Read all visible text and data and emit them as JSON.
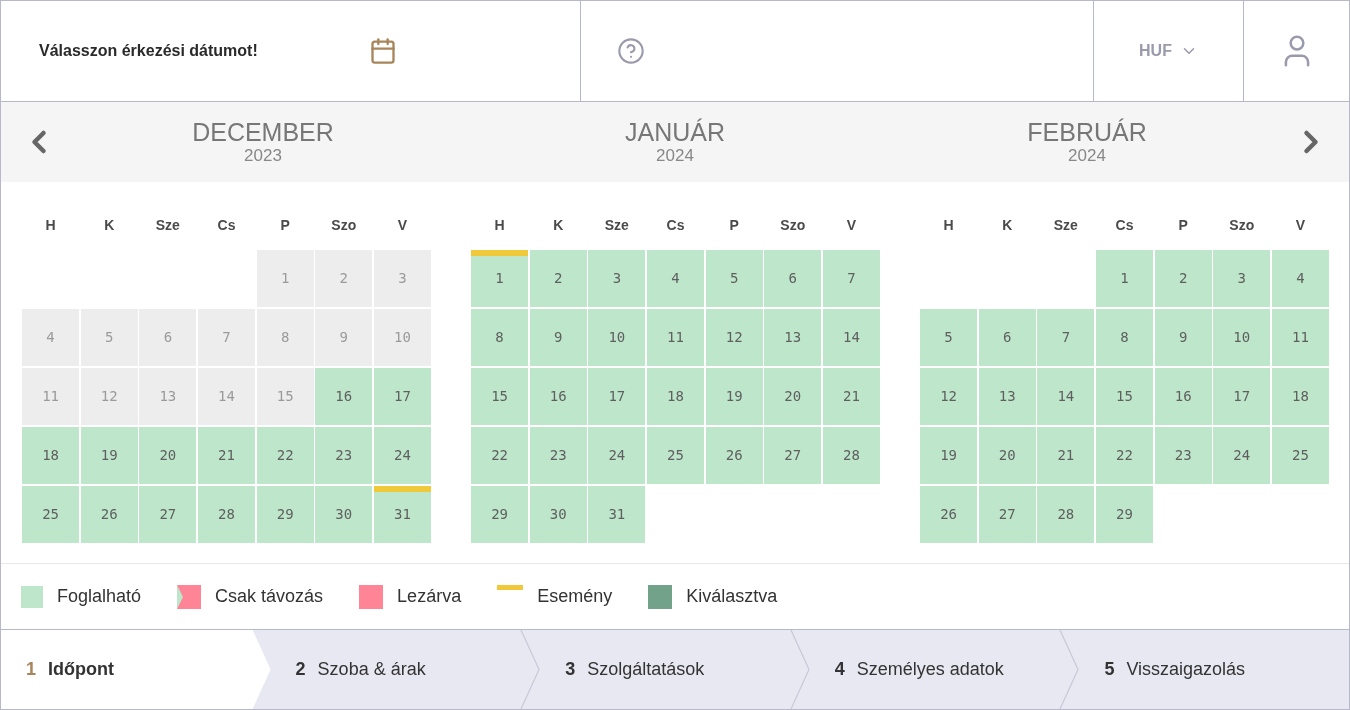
{
  "header": {
    "prompt": "Válasszon érkezési dátumot!",
    "currency": "HUF"
  },
  "months": [
    {
      "name": "DECEMBER",
      "year": "2023",
      "weekdays": [
        "H",
        "K",
        "Sze",
        "Cs",
        "P",
        "Szo",
        "V"
      ],
      "weeks": [
        [
          {
            "kind": "empty"
          },
          {
            "kind": "empty"
          },
          {
            "kind": "empty"
          },
          {
            "kind": "empty"
          },
          {
            "kind": "day",
            "label": "1",
            "disabled": true,
            "event": false
          },
          {
            "kind": "day",
            "label": "2",
            "disabled": true,
            "event": false
          },
          {
            "kind": "day",
            "label": "3",
            "disabled": true,
            "event": false
          }
        ],
        [
          {
            "kind": "day",
            "label": "4",
            "disabled": true,
            "event": false
          },
          {
            "kind": "day",
            "label": "5",
            "disabled": true,
            "event": false
          },
          {
            "kind": "day",
            "label": "6",
            "disabled": true,
            "event": false
          },
          {
            "kind": "day",
            "label": "7",
            "disabled": true,
            "event": false
          },
          {
            "kind": "day",
            "label": "8",
            "disabled": true,
            "event": false
          },
          {
            "kind": "day",
            "label": "9",
            "disabled": true,
            "event": false
          },
          {
            "kind": "day",
            "label": "10",
            "disabled": true,
            "event": false
          }
        ],
        [
          {
            "kind": "day",
            "label": "11",
            "disabled": true,
            "event": false
          },
          {
            "kind": "day",
            "label": "12",
            "disabled": true,
            "event": false
          },
          {
            "kind": "day",
            "label": "13",
            "disabled": true,
            "event": false
          },
          {
            "kind": "day",
            "label": "14",
            "disabled": true,
            "event": false
          },
          {
            "kind": "day",
            "label": "15",
            "disabled": true,
            "event": false
          },
          {
            "kind": "day",
            "label": "16",
            "disabled": false,
            "event": false
          },
          {
            "kind": "day",
            "label": "17",
            "disabled": false,
            "event": false
          }
        ],
        [
          {
            "kind": "day",
            "label": "18",
            "disabled": false,
            "event": false
          },
          {
            "kind": "day",
            "label": "19",
            "disabled": false,
            "event": false
          },
          {
            "kind": "day",
            "label": "20",
            "disabled": false,
            "event": false
          },
          {
            "kind": "day",
            "label": "21",
            "disabled": false,
            "event": false
          },
          {
            "kind": "day",
            "label": "22",
            "disabled": false,
            "event": false
          },
          {
            "kind": "day",
            "label": "23",
            "disabled": false,
            "event": false
          },
          {
            "kind": "day",
            "label": "24",
            "disabled": false,
            "event": false
          }
        ],
        [
          {
            "kind": "day",
            "label": "25",
            "disabled": false,
            "event": false
          },
          {
            "kind": "day",
            "label": "26",
            "disabled": false,
            "event": false
          },
          {
            "kind": "day",
            "label": "27",
            "disabled": false,
            "event": false
          },
          {
            "kind": "day",
            "label": "28",
            "disabled": false,
            "event": false
          },
          {
            "kind": "day",
            "label": "29",
            "disabled": false,
            "event": false
          },
          {
            "kind": "day",
            "label": "30",
            "disabled": false,
            "event": false
          },
          {
            "kind": "day",
            "label": "31",
            "disabled": false,
            "event": true
          }
        ]
      ]
    },
    {
      "name": "JANUÁR",
      "year": "2024",
      "weekdays": [
        "H",
        "K",
        "Sze",
        "Cs",
        "P",
        "Szo",
        "V"
      ],
      "weeks": [
        [
          {
            "kind": "day",
            "label": "1",
            "disabled": false,
            "event": true
          },
          {
            "kind": "day",
            "label": "2",
            "disabled": false,
            "event": false
          },
          {
            "kind": "day",
            "label": "3",
            "disabled": false,
            "event": false
          },
          {
            "kind": "day",
            "label": "4",
            "disabled": false,
            "event": false
          },
          {
            "kind": "day",
            "label": "5",
            "disabled": false,
            "event": false
          },
          {
            "kind": "day",
            "label": "6",
            "disabled": false,
            "event": false
          },
          {
            "kind": "day",
            "label": "7",
            "disabled": false,
            "event": false
          }
        ],
        [
          {
            "kind": "day",
            "label": "8",
            "disabled": false,
            "event": false
          },
          {
            "kind": "day",
            "label": "9",
            "disabled": false,
            "event": false
          },
          {
            "kind": "day",
            "label": "10",
            "disabled": false,
            "event": false
          },
          {
            "kind": "day",
            "label": "11",
            "disabled": false,
            "event": false
          },
          {
            "kind": "day",
            "label": "12",
            "disabled": false,
            "event": false
          },
          {
            "kind": "day",
            "label": "13",
            "disabled": false,
            "event": false
          },
          {
            "kind": "day",
            "label": "14",
            "disabled": false,
            "event": false
          }
        ],
        [
          {
            "kind": "day",
            "label": "15",
            "disabled": false,
            "event": false
          },
          {
            "kind": "day",
            "label": "16",
            "disabled": false,
            "event": false
          },
          {
            "kind": "day",
            "label": "17",
            "disabled": false,
            "event": false
          },
          {
            "kind": "day",
            "label": "18",
            "disabled": false,
            "event": false
          },
          {
            "kind": "day",
            "label": "19",
            "disabled": false,
            "event": false
          },
          {
            "kind": "day",
            "label": "20",
            "disabled": false,
            "event": false
          },
          {
            "kind": "day",
            "label": "21",
            "disabled": false,
            "event": false
          }
        ],
        [
          {
            "kind": "day",
            "label": "22",
            "disabled": false,
            "event": false
          },
          {
            "kind": "day",
            "label": "23",
            "disabled": false,
            "event": false
          },
          {
            "kind": "day",
            "label": "24",
            "disabled": false,
            "event": false
          },
          {
            "kind": "day",
            "label": "25",
            "disabled": false,
            "event": false
          },
          {
            "kind": "day",
            "label": "26",
            "disabled": false,
            "event": false
          },
          {
            "kind": "day",
            "label": "27",
            "disabled": false,
            "event": false
          },
          {
            "kind": "day",
            "label": "28",
            "disabled": false,
            "event": false
          }
        ],
        [
          {
            "kind": "day",
            "label": "29",
            "disabled": false,
            "event": false
          },
          {
            "kind": "day",
            "label": "30",
            "disabled": false,
            "event": false
          },
          {
            "kind": "day",
            "label": "31",
            "disabled": false,
            "event": false
          },
          {
            "kind": "empty"
          },
          {
            "kind": "empty"
          },
          {
            "kind": "empty"
          },
          {
            "kind": "empty"
          }
        ]
      ]
    },
    {
      "name": "FEBRUÁR",
      "year": "2024",
      "weekdays": [
        "H",
        "K",
        "Sze",
        "Cs",
        "P",
        "Szo",
        "V"
      ],
      "weeks": [
        [
          {
            "kind": "empty"
          },
          {
            "kind": "empty"
          },
          {
            "kind": "empty"
          },
          {
            "kind": "day",
            "label": "1",
            "disabled": false,
            "event": false
          },
          {
            "kind": "day",
            "label": "2",
            "disabled": false,
            "event": false
          },
          {
            "kind": "day",
            "label": "3",
            "disabled": false,
            "event": false
          },
          {
            "kind": "day",
            "label": "4",
            "disabled": false,
            "event": false
          }
        ],
        [
          {
            "kind": "day",
            "label": "5",
            "disabled": false,
            "event": false
          },
          {
            "kind": "day",
            "label": "6",
            "disabled": false,
            "event": false
          },
          {
            "kind": "day",
            "label": "7",
            "disabled": false,
            "event": false
          },
          {
            "kind": "day",
            "label": "8",
            "disabled": false,
            "event": false
          },
          {
            "kind": "day",
            "label": "9",
            "disabled": false,
            "event": false
          },
          {
            "kind": "day",
            "label": "10",
            "disabled": false,
            "event": false
          },
          {
            "kind": "day",
            "label": "11",
            "disabled": false,
            "event": false
          }
        ],
        [
          {
            "kind": "day",
            "label": "12",
            "disabled": false,
            "event": false
          },
          {
            "kind": "day",
            "label": "13",
            "disabled": false,
            "event": false
          },
          {
            "kind": "day",
            "label": "14",
            "disabled": false,
            "event": false
          },
          {
            "kind": "day",
            "label": "15",
            "disabled": false,
            "event": false
          },
          {
            "kind": "day",
            "label": "16",
            "disabled": false,
            "event": false
          },
          {
            "kind": "day",
            "label": "17",
            "disabled": false,
            "event": false
          },
          {
            "kind": "day",
            "label": "18",
            "disabled": false,
            "event": false
          }
        ],
        [
          {
            "kind": "day",
            "label": "19",
            "disabled": false,
            "event": false
          },
          {
            "kind": "day",
            "label": "20",
            "disabled": false,
            "event": false
          },
          {
            "kind": "day",
            "label": "21",
            "disabled": false,
            "event": false
          },
          {
            "kind": "day",
            "label": "22",
            "disabled": false,
            "event": false
          },
          {
            "kind": "day",
            "label": "23",
            "disabled": false,
            "event": false
          },
          {
            "kind": "day",
            "label": "24",
            "disabled": false,
            "event": false
          },
          {
            "kind": "day",
            "label": "25",
            "disabled": false,
            "event": false
          }
        ],
        [
          {
            "kind": "day",
            "label": "26",
            "disabled": false,
            "event": false
          },
          {
            "kind": "day",
            "label": "27",
            "disabled": false,
            "event": false
          },
          {
            "kind": "day",
            "label": "28",
            "disabled": false,
            "event": false
          },
          {
            "kind": "day",
            "label": "29",
            "disabled": false,
            "event": false
          },
          {
            "kind": "empty"
          },
          {
            "kind": "empty"
          },
          {
            "kind": "empty"
          }
        ]
      ]
    }
  ],
  "legend": [
    {
      "kind": "available",
      "label": "Foglalható"
    },
    {
      "kind": "departure",
      "label": "Csak távozás"
    },
    {
      "kind": "closed",
      "label": "Lezárva"
    },
    {
      "kind": "event",
      "label": "Esemény"
    },
    {
      "kind": "selected",
      "label": "Kiválasztva"
    }
  ],
  "steps": [
    {
      "number": "1",
      "label": "Időpont",
      "selected": true
    },
    {
      "number": "2",
      "label": "Szoba & árak",
      "selected": false
    },
    {
      "number": "3",
      "label": "Szolgáltatások",
      "selected": false
    },
    {
      "number": "4",
      "label": "Személyes adatok",
      "selected": false
    },
    {
      "number": "5",
      "label": "Visszaigazolás",
      "selected": false
    }
  ]
}
